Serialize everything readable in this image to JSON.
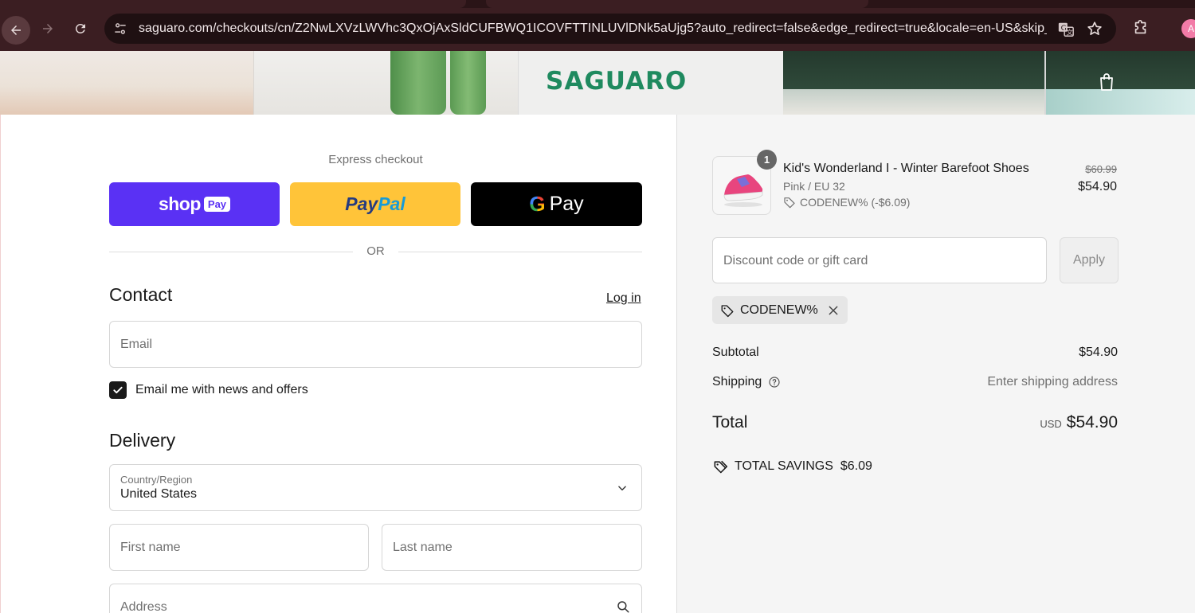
{
  "browser": {
    "url": "saguaro.com/checkouts/cn/Z2NwLXVzLWVhc3QxOjAxSldCUFBWQ1ICOVFTTINLUVlDNk5aUjg5?auto_redirect=false&edge_redirect=true&locale=en-US&skip_s...",
    "profile_initial": "A"
  },
  "header": {
    "logo": "SAGUARO"
  },
  "express": {
    "label": "Express checkout",
    "shop_wordmark": "shop",
    "shop_pay": "Pay",
    "paypal_a": "Pay",
    "paypal_b": "Pal",
    "gpay_g": "G",
    "gpay_pay": "Pay",
    "or": "OR"
  },
  "contact": {
    "title": "Contact",
    "login": "Log in",
    "email_placeholder": "Email",
    "newsletter_label": "Email me with news and offers",
    "newsletter_checked": true
  },
  "delivery": {
    "title": "Delivery",
    "country_label": "Country/Region",
    "country_value": "United States",
    "first_name_placeholder": "First name",
    "last_name_placeholder": "Last name",
    "address_placeholder": "Address"
  },
  "order": {
    "item": {
      "quantity": "1",
      "name": "Kid's Wonderland I - Winter Barefoot Shoes",
      "variant": "Pink / EU 32",
      "discount": "CODENEW% (-$6.09)",
      "original_price": "$60.99",
      "price": "$54.90"
    },
    "discount_placeholder": "Discount code or gift card",
    "apply_label": "Apply",
    "applied_code": "CODENEW%",
    "subtotal_label": "Subtotal",
    "subtotal_value": "$54.90",
    "shipping_label": "Shipping",
    "shipping_value": "Enter shipping address",
    "total_label": "Total",
    "total_currency": "USD",
    "total_value": "$54.90",
    "savings_label": "TOTAL SAVINGS",
    "savings_value": "$6.09"
  },
  "colors": {
    "shop_pay": "#5a31f4",
    "paypal": "#ffc439",
    "gpay": "#000000",
    "brand_green": "#1f8a5f"
  }
}
